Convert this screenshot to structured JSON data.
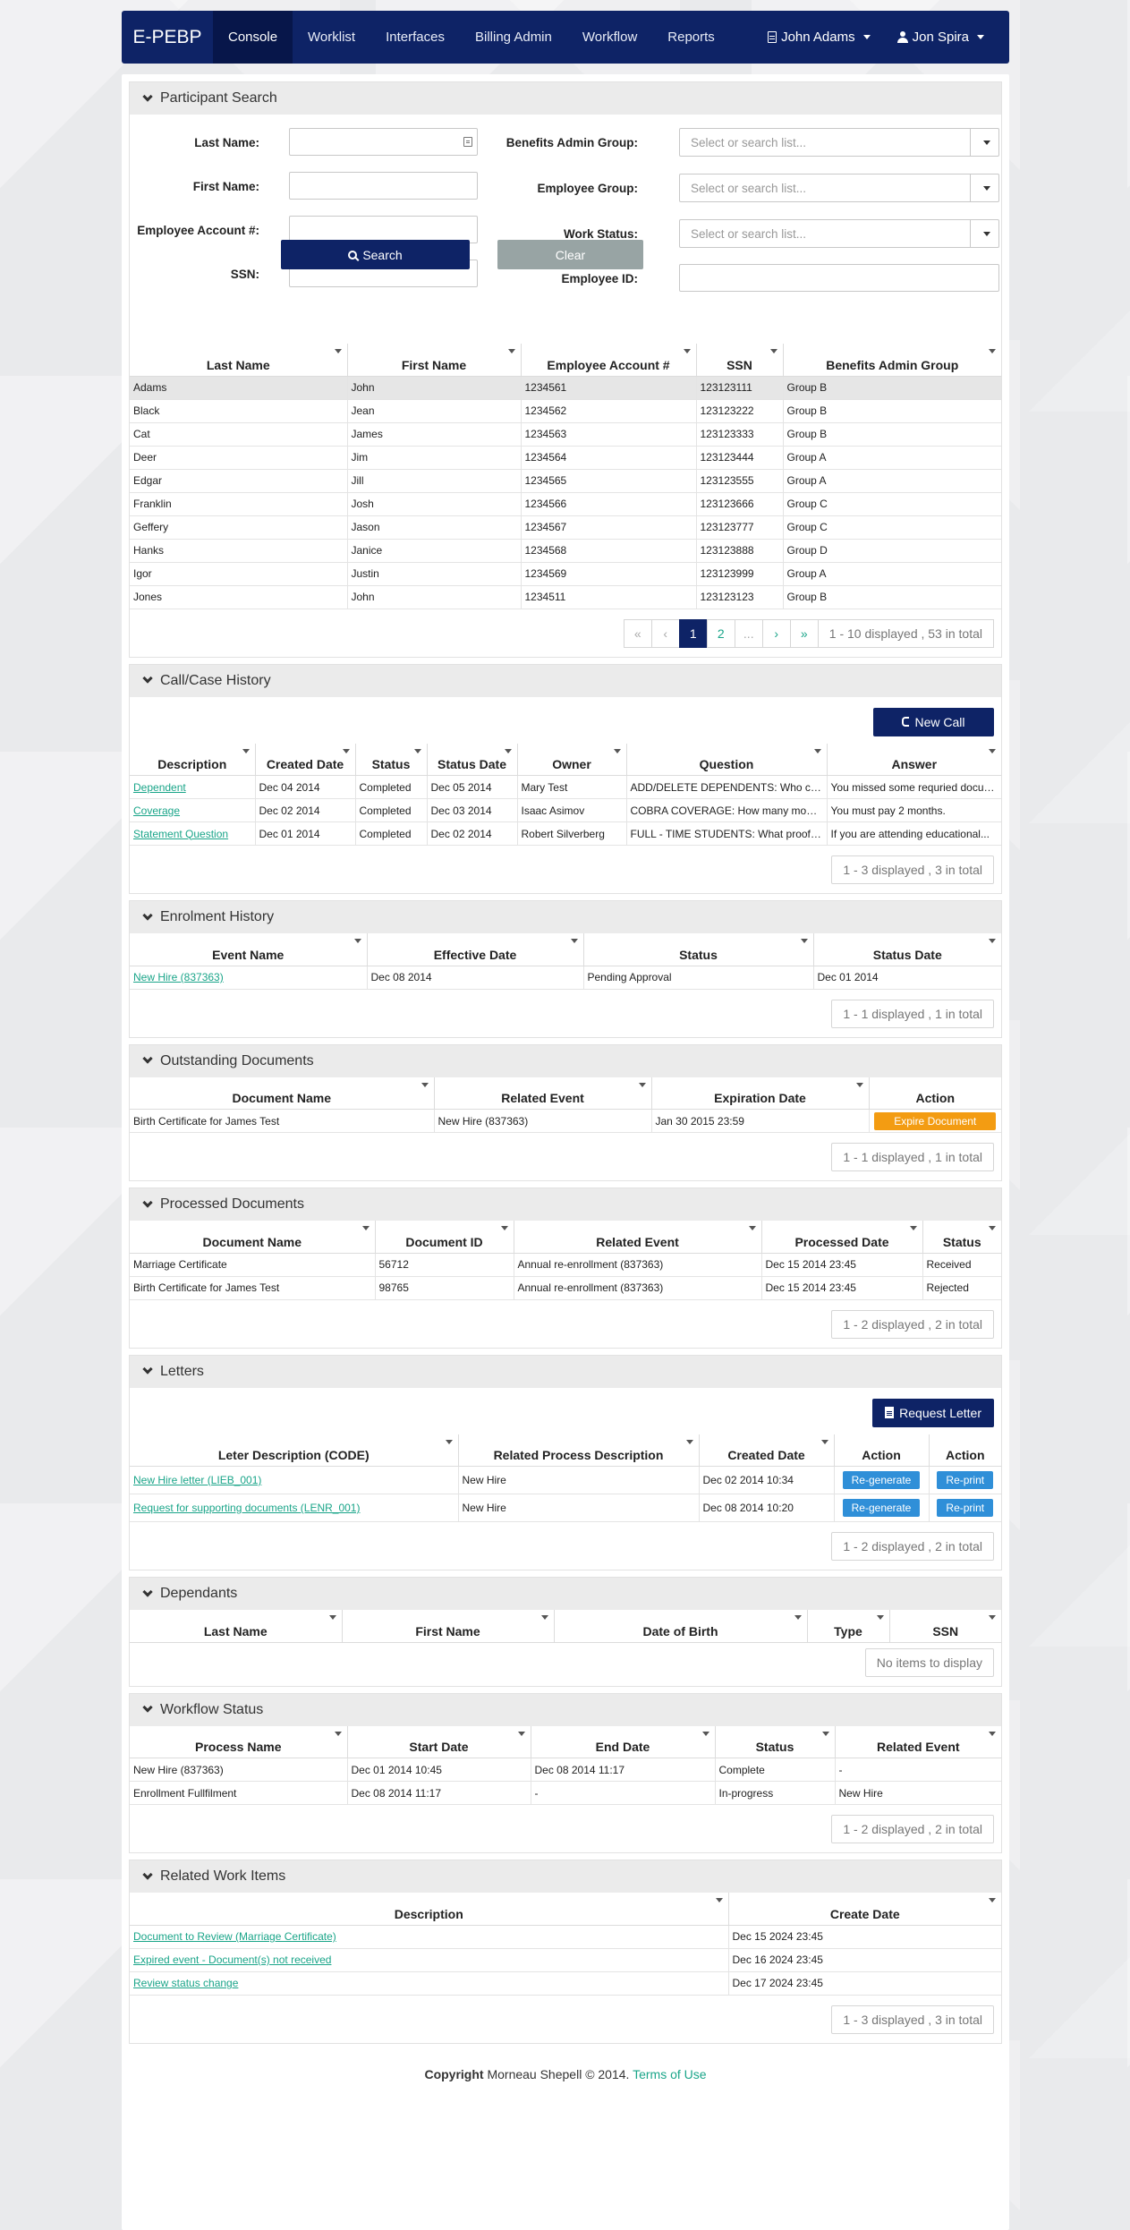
{
  "nav": {
    "brand": "E-PEBP",
    "items": [
      "Console",
      "Worklist",
      "Interfaces",
      "Billing Admin",
      "Workflow",
      "Reports"
    ],
    "user1": "John Adams",
    "user2": "Jon Spira"
  },
  "participant_search": {
    "title": "Participant Search",
    "labels": {
      "last_name": "Last Name:",
      "first_name": "First Name:",
      "account": "Employee Account #:",
      "ssn": "SSN:",
      "benefits_group": "Benefits Admin Group:",
      "employee_group": "Employee Group:",
      "work_status": "Work Status:",
      "employee_id": "Employee ID:"
    },
    "select_placeholder": "Select or search list...",
    "search_label": "Search",
    "clear_label": "Clear",
    "columns": [
      "Last Name",
      "First Name",
      "Employee Account #",
      "SSN",
      "Benefits Admin Group"
    ],
    "rows": [
      [
        "Adams",
        "John",
        "1234561",
        "123123111",
        "Group B"
      ],
      [
        "Black",
        "Jean",
        "1234562",
        "123123222",
        "Group B"
      ],
      [
        "Cat",
        "James",
        "1234563",
        "123123333",
        "Group B"
      ],
      [
        "Deer",
        "Jim",
        "1234564",
        "123123444",
        "Group A"
      ],
      [
        "Edgar",
        "Jill",
        "1234565",
        "123123555",
        "Group A"
      ],
      [
        "Franklin",
        "Josh",
        "1234566",
        "123123666",
        "Group C"
      ],
      [
        "Geffery",
        "Jason",
        "1234567",
        "123123777",
        "Group C"
      ],
      [
        "Hanks",
        "Janice",
        "1234568",
        "123123888",
        "Group D"
      ],
      [
        "Igor",
        "Justin",
        "1234569",
        "123123999",
        "Group A"
      ],
      [
        "Jones",
        "John",
        "1234511",
        "123123123",
        "Group B"
      ]
    ],
    "pager": [
      "«",
      "‹",
      "1",
      "2",
      "...",
      "›",
      "»"
    ],
    "pager_info": "1 - 10 displayed , 53 in total"
  },
  "call_history": {
    "title": "Call/Case History",
    "new_call_label": "New Call",
    "columns": [
      "Description",
      "Created Date",
      "Status",
      "Status Date",
      "Owner",
      "Question",
      "Answer"
    ],
    "rows": [
      [
        "Dependent",
        "Dec 04 2014",
        "Completed",
        "Dec 05 2014",
        "Mary Test",
        "ADD/DELETE DEPENDENTS: Who can I cover as a...",
        "You missed some requried documents..."
      ],
      [
        "Coverage",
        "Dec 02 2014",
        "Completed",
        "Dec 03 2014",
        "Isaac Asimov",
        "COBRA COVERAGE: How many months do I have...",
        "You must pay 2 months."
      ],
      [
        "Statement Question",
        "Dec 01 2014",
        "Completed",
        "Dec 02 2014",
        "Robert Silverberg",
        "FULL - TIME STUDENTS: What proof do I need...",
        "If you are attending educational..."
      ]
    ],
    "info": "1 - 3 displayed , 3 in total"
  },
  "enrolment_history": {
    "title": "Enrolment History",
    "columns": [
      "Event Name",
      "Effective Date",
      "Status",
      "Status Date"
    ],
    "rows": [
      [
        "New Hire (837363)",
        "Dec 08 2014",
        "Pending Approval",
        "Dec 01 2014"
      ]
    ],
    "info": "1 - 1 displayed , 1 in total"
  },
  "outstanding_documents": {
    "title": "Outstanding Documents",
    "columns": [
      "Document Name",
      "Related Event",
      "Expiration Date",
      "Action"
    ],
    "rows": [
      [
        "Birth Certificate for James Test",
        "New Hire (837363)",
        "Jan 30 2015 23:59"
      ]
    ],
    "action_label": "Expire Document",
    "info": "1 - 1 displayed , 1 in total"
  },
  "processed_documents": {
    "title": "Processed Documents",
    "columns": [
      "Document Name",
      "Document ID",
      "Related Event",
      "Processed Date",
      "Status"
    ],
    "rows": [
      [
        "Marriage Certificate",
        "56712",
        "Annual re-enrollment (837363)",
        "Dec 15 2014 23:45",
        "Received"
      ],
      [
        "Birth Certificate for James Test",
        "98765",
        "Annual re-enrollment (837363)",
        "Dec 15 2014 23:45",
        "Rejected"
      ]
    ],
    "info": "1 - 2 displayed , 2 in total"
  },
  "letters": {
    "title": "Letters",
    "request_label": "Request Letter",
    "columns": [
      "Leter Description (CODE)",
      "Related Process Description",
      "Created Date",
      "Action",
      "Action"
    ],
    "rows": [
      [
        "New Hire letter (LIEB_001)",
        "New Hire",
        "Dec 02 2014 10:34"
      ],
      [
        "Request for supporting documents (LENR_001)",
        "New Hire",
        "Dec 08 2014 10:20"
      ]
    ],
    "regenerate_label": "Re-generate",
    "reprint_label": "Re-print",
    "info": "1 - 2 displayed , 2 in total"
  },
  "dependants": {
    "title": "Dependants",
    "columns": [
      "Last Name",
      "First Name",
      "Date of Birth",
      "Type",
      "SSN"
    ],
    "info": "No items to display"
  },
  "workflow_status": {
    "title": "Workflow Status",
    "columns": [
      "Process Name",
      "Start Date",
      "End Date",
      "Status",
      "Related Event"
    ],
    "rows": [
      [
        "New Hire (837363)",
        "Dec 01 2014 10:45",
        "Dec 08 2014 11:17",
        "Complete",
        "-"
      ],
      [
        "Enrollment Fullfilment",
        "Dec 08 2014 11:17",
        "-",
        "In-progress",
        "New Hire"
      ]
    ],
    "info": "1 - 2 displayed , 2 in total"
  },
  "related_work_items": {
    "title": "Related Work Items",
    "columns": [
      "Description",
      "Create Date"
    ],
    "rows": [
      [
        "Document to Review (Marriage Certificate)",
        "Dec 15 2024 23:45"
      ],
      [
        "Expired event - Document(s) not received",
        "Dec 16 2024 23:45"
      ],
      [
        "Review status change",
        "Dec 17 2024 23:45"
      ]
    ],
    "info": "1 - 3 displayed , 3 in total"
  },
  "footer": {
    "copyright": "Copyright",
    "company": " Morneau Shepell © 2014. ",
    "terms": "Terms of Use"
  }
}
